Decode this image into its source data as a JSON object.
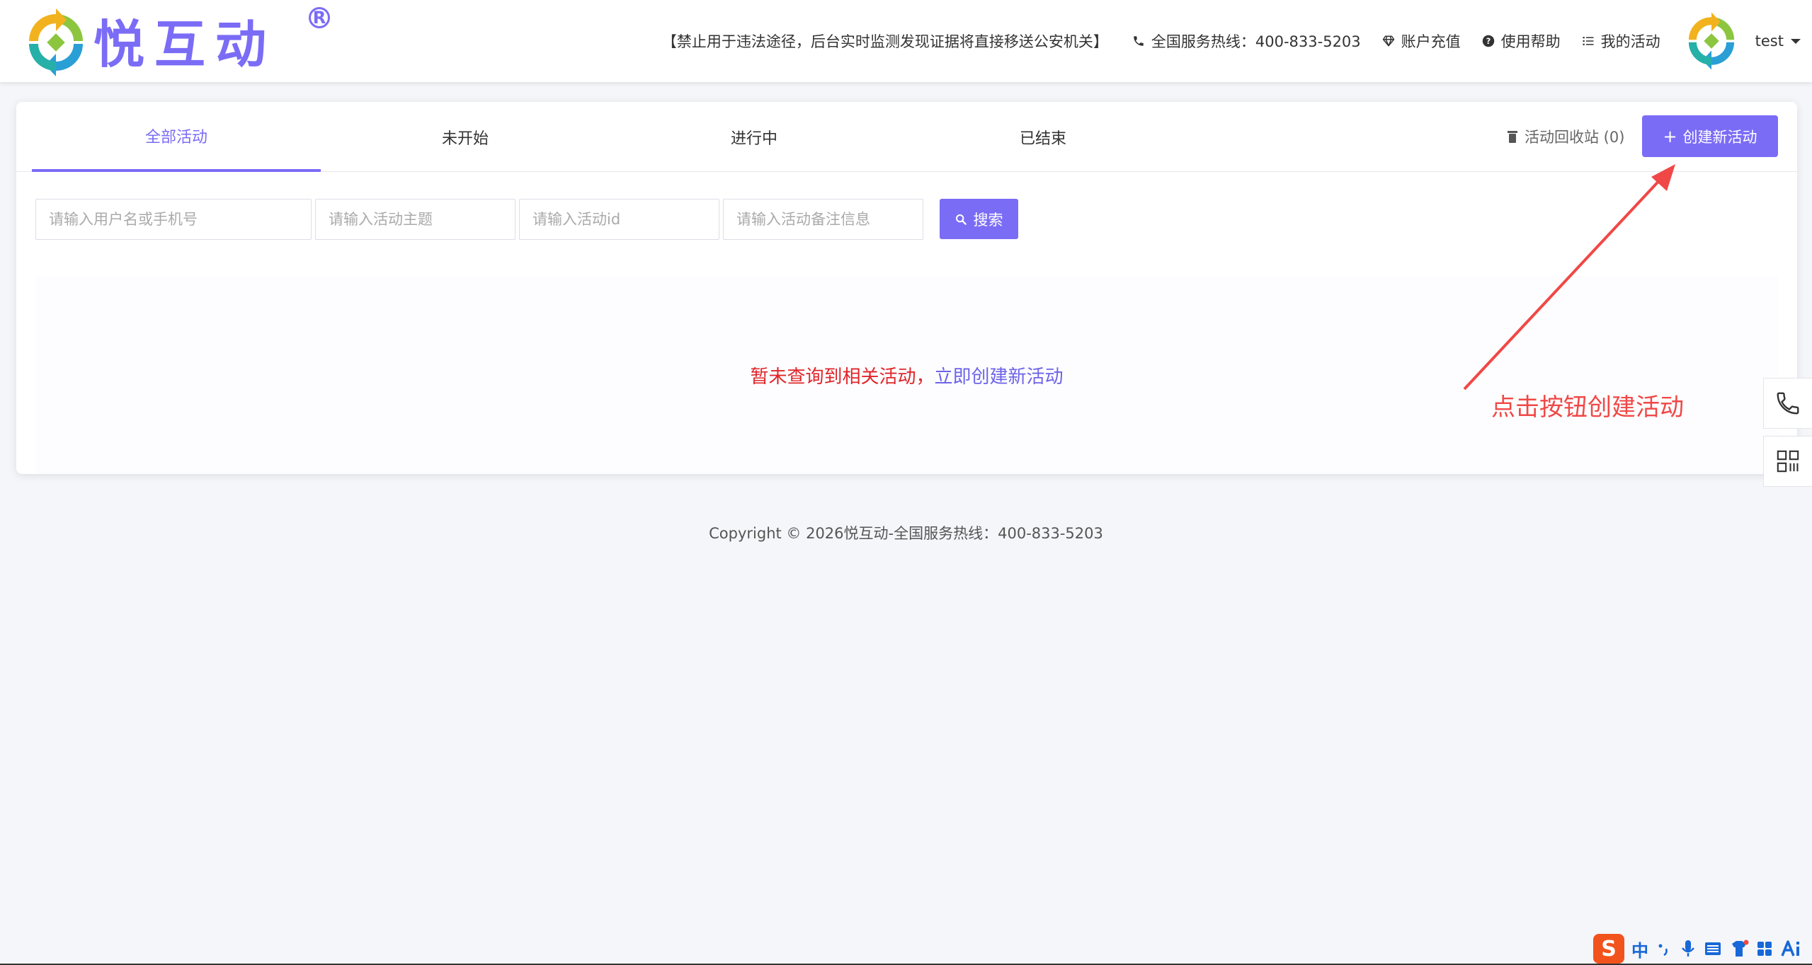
{
  "header": {
    "logo_text": "悦互动",
    "logo_reg": "R",
    "notice": "【禁止用于违法途径，后台实时监测发现证据将直接移送公安机关】",
    "hotline": "全国服务热线：400-833-5203",
    "recharge": "账户充值",
    "help": "使用帮助",
    "my_activities": "我的活动",
    "username": "test",
    "icons": {
      "hotline": "phone-icon",
      "recharge": "diamond-icon",
      "help": "question-circle-icon",
      "my_activities": "list-icon"
    }
  },
  "tabs": [
    {
      "label": "全部活动",
      "active": true
    },
    {
      "label": "未开始",
      "active": false
    },
    {
      "label": "进行中",
      "active": false
    },
    {
      "label": "已结束",
      "active": false
    }
  ],
  "recycle_bin": {
    "label": "活动回收站 (0)"
  },
  "create_button": {
    "label": "创建新活动",
    "icon": "+"
  },
  "filters": {
    "user_placeholder": "请输入用户名或手机号",
    "topic_placeholder": "请输入活动主题",
    "id_placeholder": "请输入活动id",
    "note_placeholder": "请输入活动备注信息",
    "search_label": "搜索"
  },
  "empty_state": {
    "message": "暂未查询到相关活动，",
    "link": "立即创建新活动"
  },
  "annotation": {
    "text": "点击按钮创建活动"
  },
  "footer": {
    "copyright": "Copyright © 2026悦互动-全国服务热线：400-833-5203"
  },
  "ime": {
    "mode": "中"
  },
  "colors": {
    "accent": "#7b6cf6",
    "error_text": "#e0252a",
    "annotation": "#f04846",
    "page_bg": "#f4f6fa"
  }
}
